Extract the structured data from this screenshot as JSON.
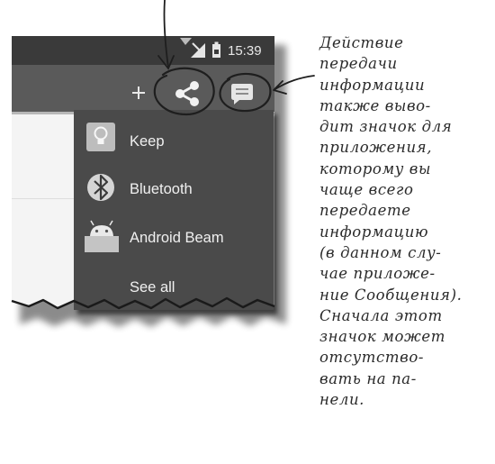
{
  "status_bar": {
    "time": "15:39"
  },
  "action_bar": {
    "icons": [
      "plus-icon",
      "share-icon",
      "messages-icon"
    ]
  },
  "share_menu": {
    "items": [
      {
        "icon": "keep-icon",
        "label": "Keep"
      },
      {
        "icon": "bluetooth-icon",
        "label": "Bluetooth"
      },
      {
        "icon": "android-beam-icon",
        "label": "Android Beam"
      }
    ],
    "see_all": "See all"
  },
  "annotation": {
    "lines": [
      "Действие",
      "передачи",
      "информации",
      "также выво-",
      "дит значок для",
      "приложения,",
      "которому вы",
      "чаще всего",
      "передаете",
      "информацию",
      "(в данном слу-",
      "чае приложе-",
      "ние Сообщения).",
      "Сначала этот",
      "значок может",
      "отсутство-",
      "вать на па-",
      "нели."
    ]
  },
  "colors": {
    "action_bar": "#5a5a5a",
    "menu_background": "#4a4a4a",
    "status_bar": "#3a3a3a",
    "content_background": "#f4f4f4"
  }
}
